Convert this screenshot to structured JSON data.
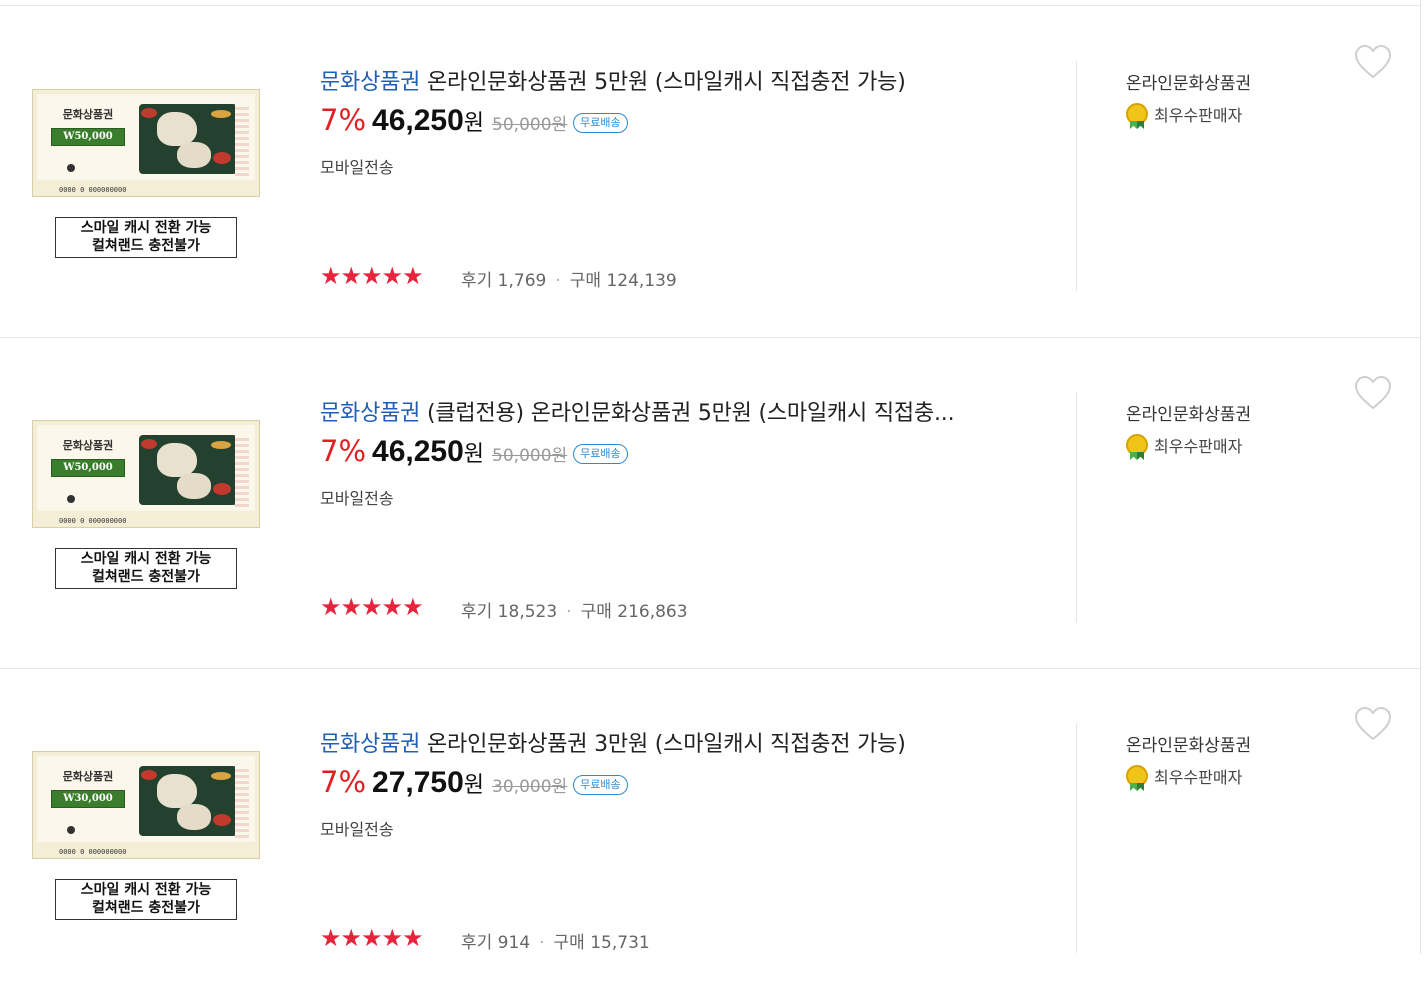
{
  "products": [
    {
      "category": "문화상품권",
      "name": "온라인문화상품권 5만원 (스마일캐시 직접충전 가능)",
      "discount_rate": "7%",
      "price": "46,250",
      "price_unit": "원",
      "original_price": "50,000원",
      "free_shipping": "무료배송",
      "delivery": "모바일전송",
      "rating_stars": "★★★★★",
      "reviews": "후기 1,769",
      "purchases": "구매 124,139",
      "seller": "온라인문화상품권",
      "seller_grade": "최우수판매자",
      "thumb": {
        "header": "문화상품권",
        "amount": "W50,000",
        "code": "0000 0 000000000",
        "note_line1": "스마일 캐시 전환 가능",
        "note_line2": "컬쳐랜드 충전불가"
      }
    },
    {
      "category": "문화상품권",
      "name": "(클럽전용) 온라인문화상품권 5만원 (스마일캐시 직접충...",
      "discount_rate": "7%",
      "price": "46,250",
      "price_unit": "원",
      "original_price": "50,000원",
      "free_shipping": "무료배송",
      "delivery": "모바일전송",
      "rating_stars": "★★★★★",
      "reviews": "후기 18,523",
      "purchases": "구매 216,863",
      "seller": "온라인문화상품권",
      "seller_grade": "최우수판매자",
      "thumb": {
        "header": "문화상품권",
        "amount": "W50,000",
        "code": "0000 0 000000000",
        "note_line1": "스마일 캐시 전환 가능",
        "note_line2": "컬쳐랜드 충전불가"
      }
    },
    {
      "category": "문화상품권",
      "name": "온라인문화상품권 3만원 (스마일캐시 직접충전 가능)",
      "discount_rate": "7%",
      "price": "27,750",
      "price_unit": "원",
      "original_price": "30,000원",
      "free_shipping": "무료배송",
      "delivery": "모바일전송",
      "rating_stars": "★★★★★",
      "reviews": "후기 914",
      "purchases": "구매 15,731",
      "seller": "온라인문화상품권",
      "seller_grade": "최우수판매자",
      "thumb": {
        "header": "문화상품권",
        "amount": "W30,000",
        "code": "0000 0 000000000",
        "note_line1": "스마일 캐시 전환 가능",
        "note_line2": "컬쳐랜드 충전불가"
      }
    }
  ],
  "colors": {
    "discount": "#e02020",
    "category_link": "#1f5fb8",
    "stars": "#e8233c",
    "free_badge": "#2b8cd6"
  },
  "icons": {
    "wishlist": "heart-outline-icon",
    "grade": "medal-icon"
  }
}
